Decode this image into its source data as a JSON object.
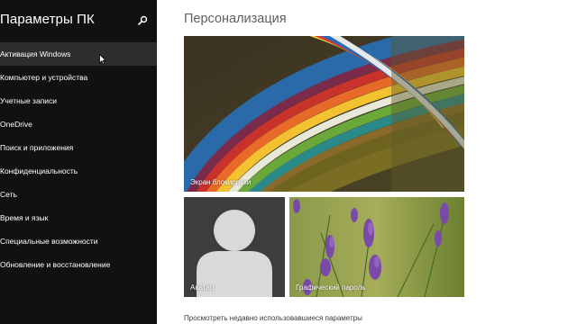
{
  "sidebar": {
    "title": "Параметры ПК",
    "items": [
      {
        "label": "Активация Windows",
        "active": true
      },
      {
        "label": "Компьютер и устройства"
      },
      {
        "label": "Учетные записи"
      },
      {
        "label": "OneDrive"
      },
      {
        "label": "Поиск и приложения"
      },
      {
        "label": "Конфиденциальность"
      },
      {
        "label": "Сеть"
      },
      {
        "label": "Время и язык"
      },
      {
        "label": "Специальные возможности"
      },
      {
        "label": "Обновление и восстановление"
      }
    ]
  },
  "main": {
    "title": "Персонализация",
    "tiles": {
      "lock_screen": "Экран блокировки",
      "avatar": "Аватар",
      "picture_password": "Графический пароль"
    },
    "recent_link": "Просмотреть недавно использовавшиеся параметры"
  },
  "colors": {
    "sidebar_bg": "#111111",
    "active_item_bg": "#2e2e2e",
    "avatar_tile_bg": "#3d3d3d"
  }
}
